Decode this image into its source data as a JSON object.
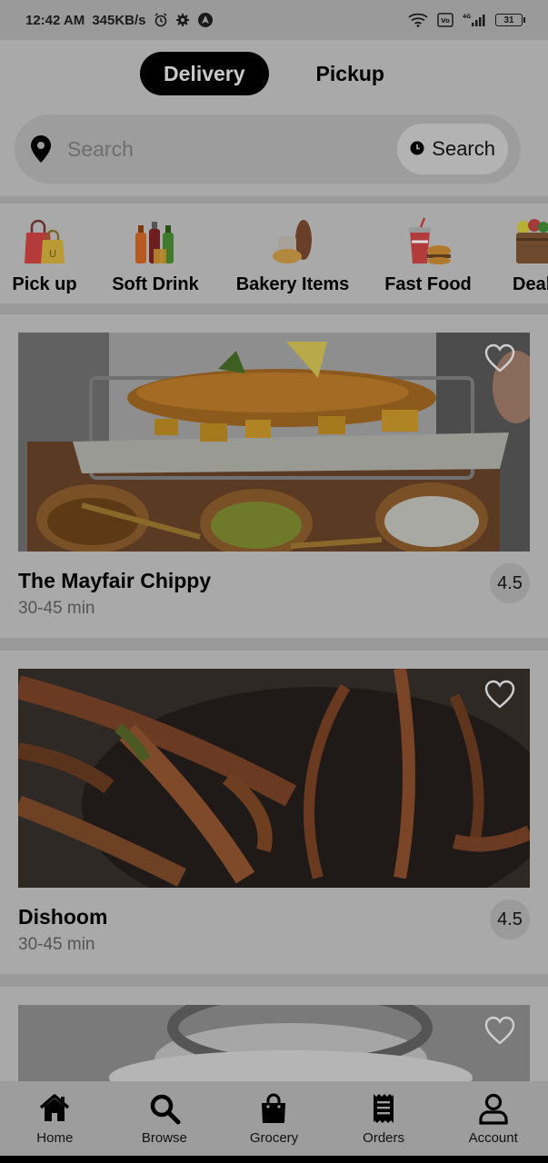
{
  "status_bar": {
    "time": "12:42 AM",
    "speed": "345KB/s",
    "battery": "31",
    "icons": [
      "alarm-icon",
      "gear-icon",
      "nav-arrow-icon",
      "wifi-icon",
      "volte-icon",
      "signal-icon",
      "battery-icon"
    ]
  },
  "mode": {
    "delivery_label": "Delivery",
    "pickup_label": "Pickup",
    "active": "delivery"
  },
  "search": {
    "placeholder": "Search",
    "button_label": "Search"
  },
  "categories": [
    {
      "label": "Pick up",
      "icon": "shopping-bag-icon"
    },
    {
      "label": "Soft Drink",
      "icon": "soft-drink-bottles-icon"
    },
    {
      "label": "Bakery Items",
      "icon": "bakery-bread-icon"
    },
    {
      "label": "Fast Food",
      "icon": "fast-food-icon"
    },
    {
      "label": "Deal",
      "icon": "grocery-basket-icon"
    }
  ],
  "restaurants": [
    {
      "name": "The Mayfair Chippy",
      "time": "30-45 min",
      "rating": "4.5",
      "image": "fish-and-chips-photo"
    },
    {
      "name": "Dishoom",
      "time": "30-45 min",
      "rating": "4.5",
      "image": "fried-okra-photo"
    },
    {
      "name": "",
      "time": "",
      "rating": "",
      "image": "white-dish-photo"
    }
  ],
  "bottom_nav": {
    "items": [
      {
        "label": "Home",
        "icon": "home-icon"
      },
      {
        "label": "Browse",
        "icon": "search-icon"
      },
      {
        "label": "Grocery",
        "icon": "shopping-bag-icon"
      },
      {
        "label": "Orders",
        "icon": "receipt-icon"
      },
      {
        "label": "Account",
        "icon": "user-icon"
      }
    ]
  },
  "colors": {
    "overlay_bg": "#a9a9a9",
    "active_toggle": "#000000",
    "rating_bg": "#9b9b9b"
  }
}
